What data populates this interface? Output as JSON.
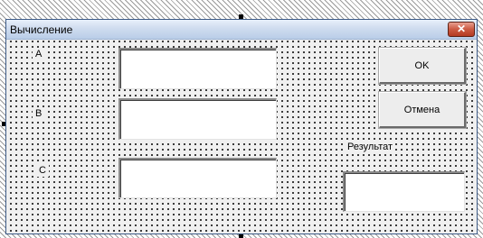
{
  "form": {
    "title": "Вычисление",
    "close_symbol": "✕"
  },
  "labels": {
    "a": "A",
    "b": "B",
    "c": "C",
    "result": "Результат"
  },
  "buttons": {
    "ok": "OK",
    "cancel": "Отмена"
  },
  "fields": {
    "a_value": "",
    "b_value": "",
    "c_value": "",
    "result_value": ""
  },
  "colors": {
    "form_background": "#f0f0f0",
    "close_button": "#cc5a42",
    "titlebar": "#cfdcef"
  }
}
